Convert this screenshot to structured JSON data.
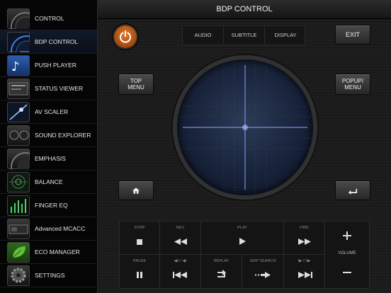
{
  "sidebar": {
    "items": [
      {
        "label": "CONTROL",
        "icon": "control-icon"
      },
      {
        "label": "BDP CONTROL",
        "icon": "bdp-control-icon",
        "active": true
      },
      {
        "label": "PUSH PLAYER",
        "icon": "push-player-icon"
      },
      {
        "label": "STATUS VIEWER",
        "icon": "status-viewer-icon"
      },
      {
        "label": "AV SCALER",
        "icon": "av-scaler-icon"
      },
      {
        "label": "SOUND EXPLORER",
        "icon": "sound-explorer-icon"
      },
      {
        "label": "EMPHASIS",
        "icon": "emphasis-icon"
      },
      {
        "label": "BALANCE",
        "icon": "balance-icon"
      },
      {
        "label": "FINGER EQ",
        "icon": "finger-eq-icon"
      },
      {
        "label": "Advanced MCACC",
        "icon": "mcacc-icon"
      },
      {
        "label": "ECO MANAGER",
        "icon": "eco-manager-icon"
      },
      {
        "label": "SETTINGS",
        "icon": "settings-icon"
      }
    ]
  },
  "header": {
    "title": "BDP CONTROL"
  },
  "top_controls": {
    "power_icon": "power-icon",
    "segments": [
      "AUDIO",
      "SUBTITLE",
      "DISPLAY"
    ],
    "exit_label": "EXIT"
  },
  "side_buttons": {
    "top_menu_line1": "TOP",
    "top_menu_line2": "MENU",
    "popup_line1": "POPUP/",
    "popup_line2": "MENU",
    "home_icon": "home-icon",
    "return_icon": "return-icon"
  },
  "playback": {
    "stop": "STOP",
    "rev": "REV",
    "play": "PLAY",
    "fwd": "FWD",
    "pause": "PAUSE",
    "step_back": "◀II / ◀I",
    "replay": "REPLAY",
    "skip_search": "SKIP SEARCH",
    "step_fwd": "I▶ / II▶",
    "volume": "VOLUME"
  },
  "colors": {
    "accent_power": "#d2691e",
    "touchpad_glow": "#5a7fd0",
    "background": "#1a1a1a"
  }
}
